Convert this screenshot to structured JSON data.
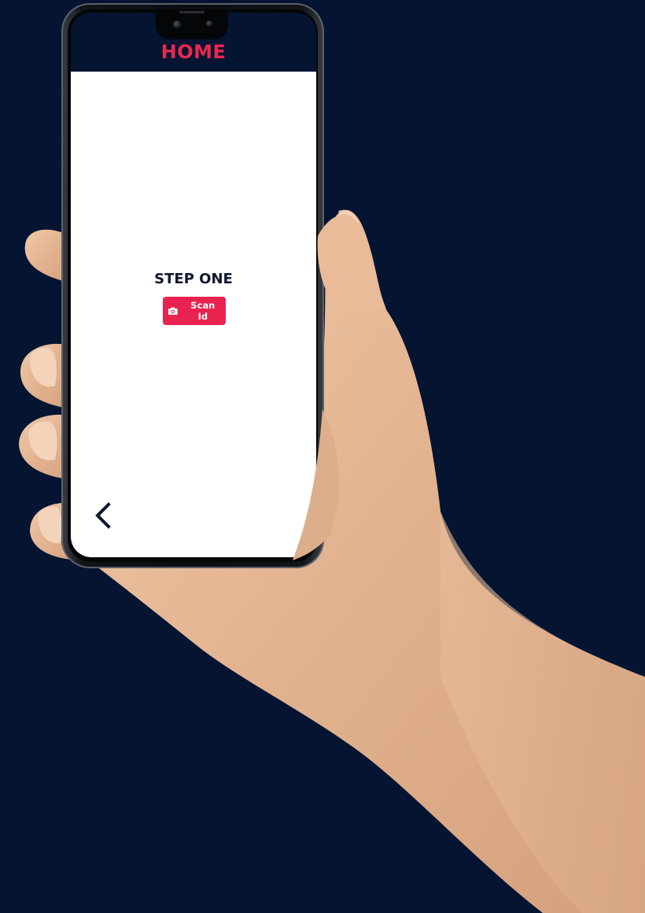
{
  "header": {
    "title": "HOME"
  },
  "main": {
    "step_title": "STEP ONE",
    "scan_button": {
      "label": "Scan Id",
      "icon": "camera-icon"
    }
  },
  "nav": {
    "back_icon": "chevron-left-icon"
  },
  "colors": {
    "background": "#041431",
    "accent": "#e8234f",
    "screen": "#ffffff",
    "text_dark": "#0e1730"
  }
}
